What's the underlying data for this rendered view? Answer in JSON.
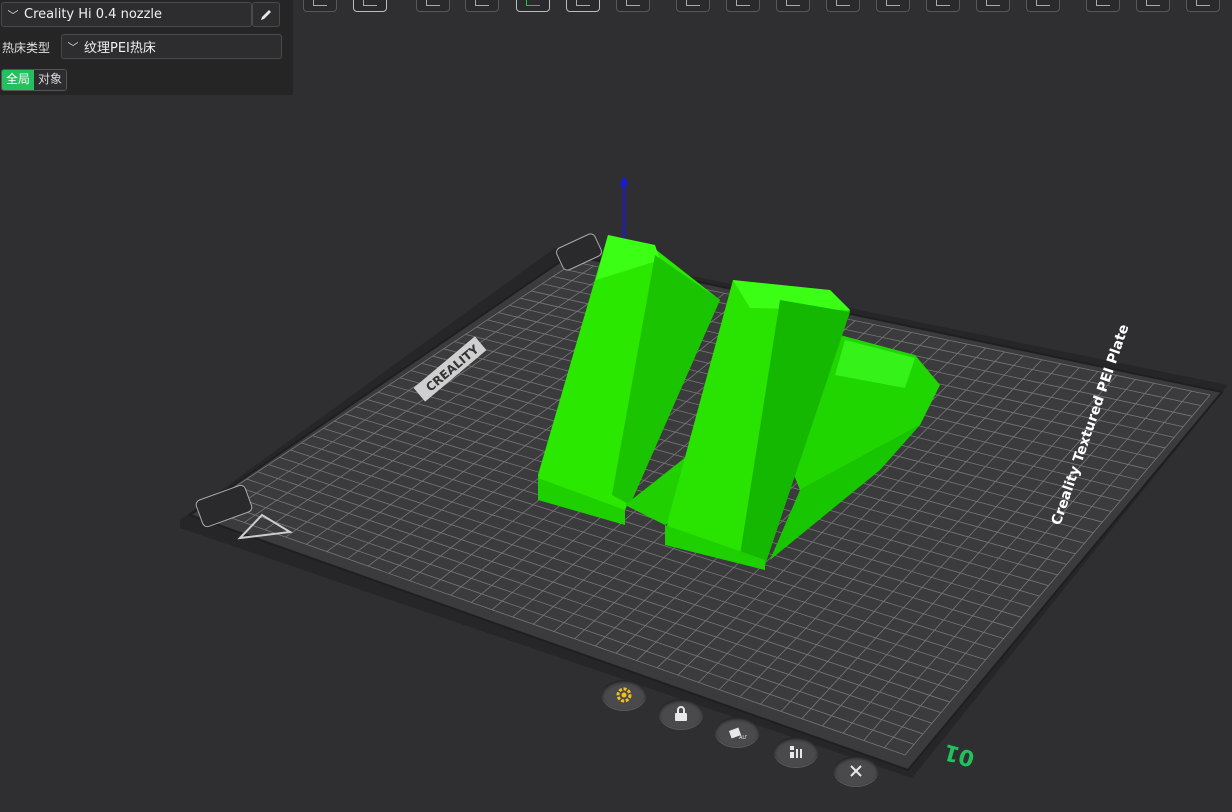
{
  "settings": {
    "printer": "Creality Hi 0.4 nozzle",
    "bed_type_label": "热床类型",
    "bed_type_value": "纹理PEI热床",
    "scope_global": "全局",
    "scope_object": "对象"
  },
  "bed": {
    "brand_text": "CREALITY",
    "plate_text": "Creality Textured PEI Plate",
    "plate_number": "01"
  },
  "toolbar_icons": [
    "add-box-icon",
    "arrange-icon",
    "orient-icon",
    "layflat-icon",
    "place-icon",
    "cut-icon",
    "measure-icon",
    "split-icon",
    "support-icon",
    "seam-icon",
    "variable-layer-icon",
    "plate-icon",
    "slice-view-icon",
    "preview-icon",
    "export-icon",
    "more-icon"
  ],
  "bottom_icons": [
    "settings-gear-icon",
    "lock-plate-icon",
    "auto-orient-icon",
    "arrange-plate-icon",
    "close-icon"
  ],
  "colors": {
    "model_green": "#22ee00",
    "accent_green": "#22c15d",
    "bed_dark": "#3b3b3d"
  }
}
